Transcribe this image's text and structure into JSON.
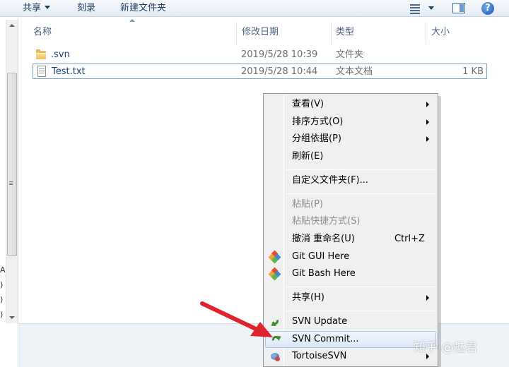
{
  "toolbar": {
    "share_label": "共享",
    "burn_label": "刻录",
    "new_folder_label": "新建文件夹"
  },
  "columns": {
    "name": "名称",
    "date": "修改日期",
    "type": "类型",
    "size": "大小"
  },
  "files": [
    {
      "name": ".svn",
      "date": "2019/5/28 10:39",
      "type": "文件夹",
      "size": "",
      "icon": "folder-icon"
    },
    {
      "name": "Test.txt",
      "date": "2019/5/28 10:44",
      "type": "文本文档",
      "size": "1 KB",
      "icon": "text-file-icon"
    }
  ],
  "context_menu": {
    "view": "查看(V)",
    "sort_by": "排序方式(O)",
    "group_by": "分组依据(P)",
    "refresh": "刷新(E)",
    "customize": "自定义文件夹(F)...",
    "paste": "粘贴(P)",
    "paste_shortcut": "粘贴快捷方式(S)",
    "undo_rename": "撤消 重命名(U)",
    "undo_shortcut": "Ctrl+Z",
    "git_gui": "Git GUI Here",
    "git_bash": "Git Bash Here",
    "share": "共享(H)",
    "svn_update": "SVN Update",
    "svn_commit": "SVN Commit...",
    "tortoise_svn": "TortoiseSVN"
  },
  "nav_bits": [
    "A",
    ")",
    ")",
    ")"
  ],
  "watermark": "知乎 @魅君",
  "colors": {
    "selection_border": "#7da2ce",
    "menu_background": "#f0f0f0",
    "menu_hover": "#dbe8f7",
    "svn_green": "#3a8c2c",
    "pointer_red": "#e0242b"
  }
}
